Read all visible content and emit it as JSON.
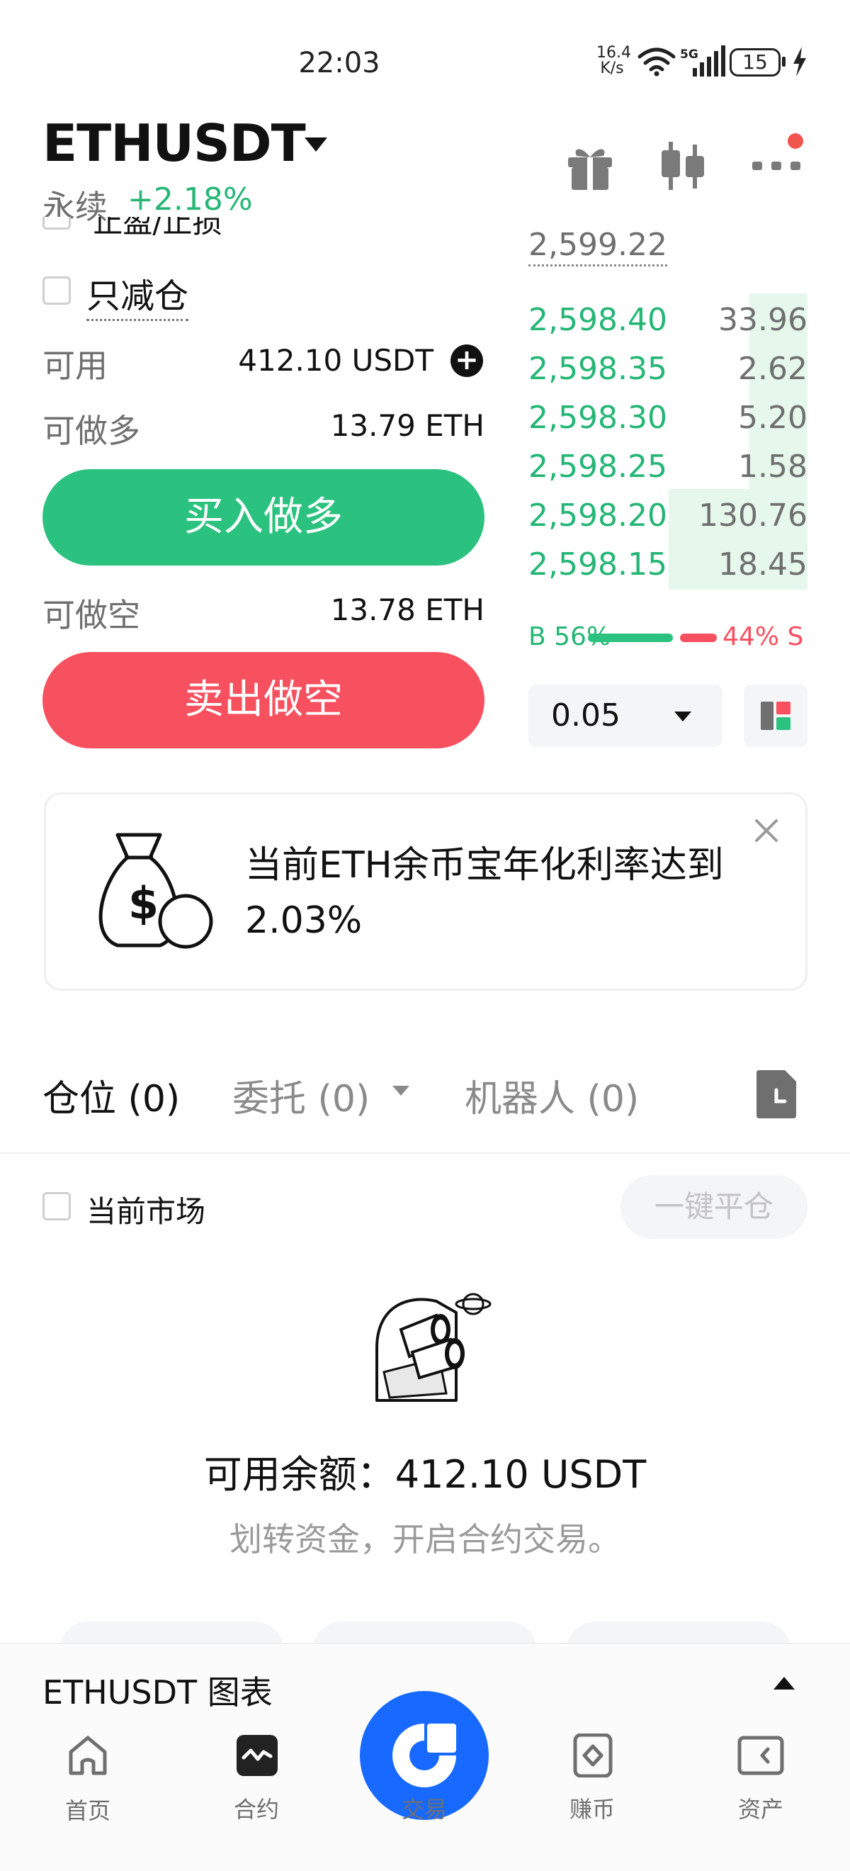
{
  "status_bar": {
    "time": "22:03",
    "net_speed_value": "16.4",
    "net_speed_unit": "K/s",
    "network": "5G",
    "battery": "15"
  },
  "header": {
    "pair": "ETHUSDT",
    "contract_type": "永续",
    "change": "+2.18%"
  },
  "order_form": {
    "cut_off_text": "止盈/止损",
    "reduce_only_label": "只减仓",
    "available_label": "可用",
    "available_value": "412.10 USDT",
    "long_label": "可做多",
    "long_value": "13.79 ETH",
    "buy_button": "买入做多",
    "short_label": "可做空",
    "short_value": "13.78 ETH",
    "sell_button": "卖出做空"
  },
  "order_book": {
    "top_price": "2,599.22",
    "bids": [
      {
        "price": "2,598.40",
        "qty": "33.96"
      },
      {
        "price": "2,598.35",
        "qty": "2.62"
      },
      {
        "price": "2,598.30",
        "qty": "5.20"
      },
      {
        "price": "2,598.25",
        "qty": "1.58"
      },
      {
        "price": "2,598.20",
        "qty": "130.76"
      },
      {
        "price": "2,598.15",
        "qty": "18.45"
      }
    ],
    "buy_ratio": "B 56%",
    "sell_ratio": "44% S",
    "depth_step": "0.05"
  },
  "promo": {
    "text": "当前ETH余币宝年化利率达到2.03%"
  },
  "tabs": {
    "positions": "仓位 (0)",
    "orders": "委托 (0)",
    "bots": "机器人 (0)"
  },
  "filters": {
    "current_market": "当前市场",
    "close_all": "一键平仓"
  },
  "empty_state": {
    "balance": "可用余额：412.10 USDT",
    "hint": "划转资金，开启合约交易。"
  },
  "chart_sheet": {
    "title": "ETHUSDT 图表"
  },
  "nav": {
    "home": "首页",
    "contract": "合约",
    "trade": "交易",
    "earn": "赚币",
    "assets": "资产"
  },
  "colors": {
    "green": "#2bc27f",
    "red": "#f7505f",
    "brand_blue": "#1769ff"
  }
}
